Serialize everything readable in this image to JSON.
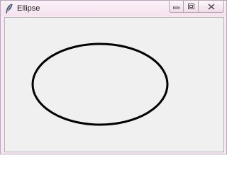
{
  "window": {
    "title": "Ellipse",
    "app_icon": "feather-icon",
    "controls": {
      "minimize_icon": "minimize-icon",
      "maximize_icon": "maximize-icon",
      "close_icon": "close-icon"
    }
  },
  "canvas": {
    "background": "#f0f0f0",
    "shape": {
      "type": "ellipse",
      "fill": "none",
      "stroke": "#000000"
    }
  }
}
